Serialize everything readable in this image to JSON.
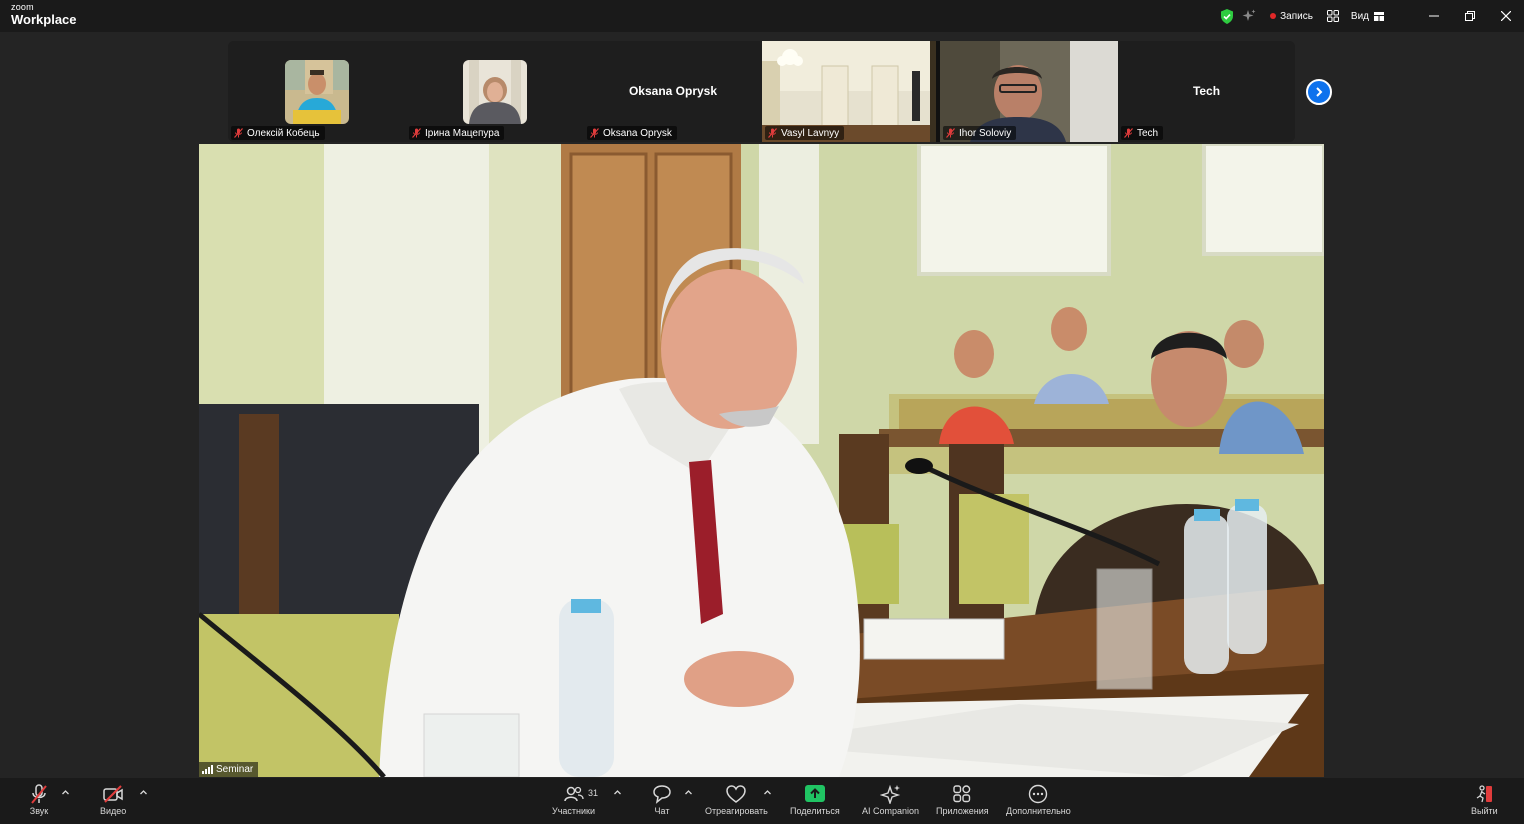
{
  "app": {
    "logo_small": "zoom",
    "logo_big": "Workplace"
  },
  "titlebar": {
    "record_label": "Запись",
    "view_label": "Вид"
  },
  "colors": {
    "accent": "#0e72ed",
    "record": "#e02828",
    "shield": "#2ecc40",
    "muted": "#e03c3c",
    "share": "#20c463"
  },
  "participants": [
    {
      "name": "Олексій Кобець",
      "type": "avatar",
      "muted": true
    },
    {
      "name": "Ірина Мацепура",
      "type": "avatar",
      "muted": true
    },
    {
      "name": "Oksana Oprysk",
      "type": "name",
      "display": "Oksana Oprysk",
      "muted": true
    },
    {
      "name": "Vasyl Lavnyy",
      "type": "video",
      "muted": true
    },
    {
      "name": "Ihor Soloviy",
      "type": "video",
      "muted": true
    },
    {
      "name": "Tech",
      "type": "name",
      "display": "Tech",
      "muted": true
    }
  ],
  "main": {
    "speaker_label": "Seminar"
  },
  "toolbar": {
    "audio": "Звук",
    "video": "Видео",
    "participants": "Участники",
    "participants_count": "31",
    "chat": "Чат",
    "react": "Отреагировать",
    "share": "Поделиться",
    "ai": "AI Companion",
    "apps": "Приложения",
    "more": "Дополнительно",
    "leave": "Выйти"
  }
}
